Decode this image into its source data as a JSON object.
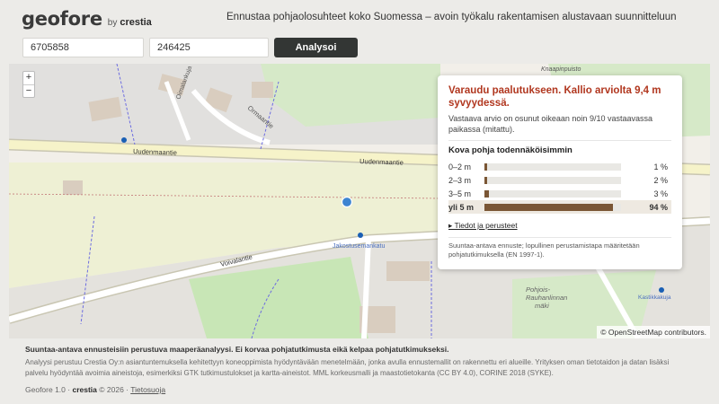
{
  "header": {
    "logo": "geofore",
    "by": "by",
    "brand": "crestia",
    "tagline": "Ennustaa pohjaolosuhteet koko Suomessa – avoin työkalu rakentamisen alustavaan suunnitteluun"
  },
  "search": {
    "north": "6705858",
    "east": "246425",
    "analyze_label": "Analysoi"
  },
  "map": {
    "zoom_in": "+",
    "zoom_out": "−",
    "attribution": "© OpenStreetMap contributors.",
    "labels": {
      "ormaantie": "Ormaantie",
      "oimalankuja": "Oimalankuja",
      "uudenmaantie_left": "Uudenmaantie",
      "uudenmaantie_right": "Uudenmaantie",
      "voivalantie": "Voivalantie",
      "jakostusemankatu": "Jakostusemankatu",
      "knaapinpuisto": "Knaapinpuisto",
      "pohjois_rauhanlinnan": "Pohjois-\nRauhanlinnan\nmäki",
      "kastikkakuja": "Kastikkakuja"
    }
  },
  "result": {
    "title": "Varaudu paalutukseen. Kallio arviolta 9,4 m syvyydessä.",
    "subtitle": "Vastaava arvio on osunut oikeaan noin 9/10 vastaavassa paikassa (mitattu).",
    "prob_title": "Kova pohja todennäköisimmin",
    "rows": [
      {
        "label": "0–2 m",
        "pct_text": "1 %",
        "value": 1
      },
      {
        "label": "2–3 m",
        "pct_text": "2 %",
        "value": 2
      },
      {
        "label": "3–5 m",
        "pct_text": "3 %",
        "value": 3
      },
      {
        "label": "yli 5 m",
        "pct_text": "94 %",
        "value": 94
      }
    ],
    "details_link": "▸ Tiedot ja perusteet",
    "note": "Suuntaa-antava ennuste; lopullinen perustamistapa määritetään pohjatutkimuksella (EN 1997-1)."
  },
  "footer": {
    "bold": "Suuntaa-antava ennusteisiin perustuva maaperäanalyysi. Ei korvaa pohjatutkimusta eikä kelpaa pohjatutkimukseksi.",
    "text": "Analyysi perustuu Crestia Oy:n asiantuntemuksella kehitettyyn koneoppimista hyödyntävään menetelmään, jonka avulla ennustemallit on rakennettu eri alueille. Yrityksen oman tietotaidon ja datan lisäksi palvelu hyödyntää avoimia aineistoja, esimerkiksi GTK tutkimustulokset ja kartta-aineistot. MML korkeusmalli ja maastotietokanta (CC BY 4.0), CORINE 2018 (SYKE).",
    "version": "Geofore 1.0 ·",
    "brand": "crestia",
    "year": "© 2026 ·",
    "privacy": "Tietosuoja"
  }
}
